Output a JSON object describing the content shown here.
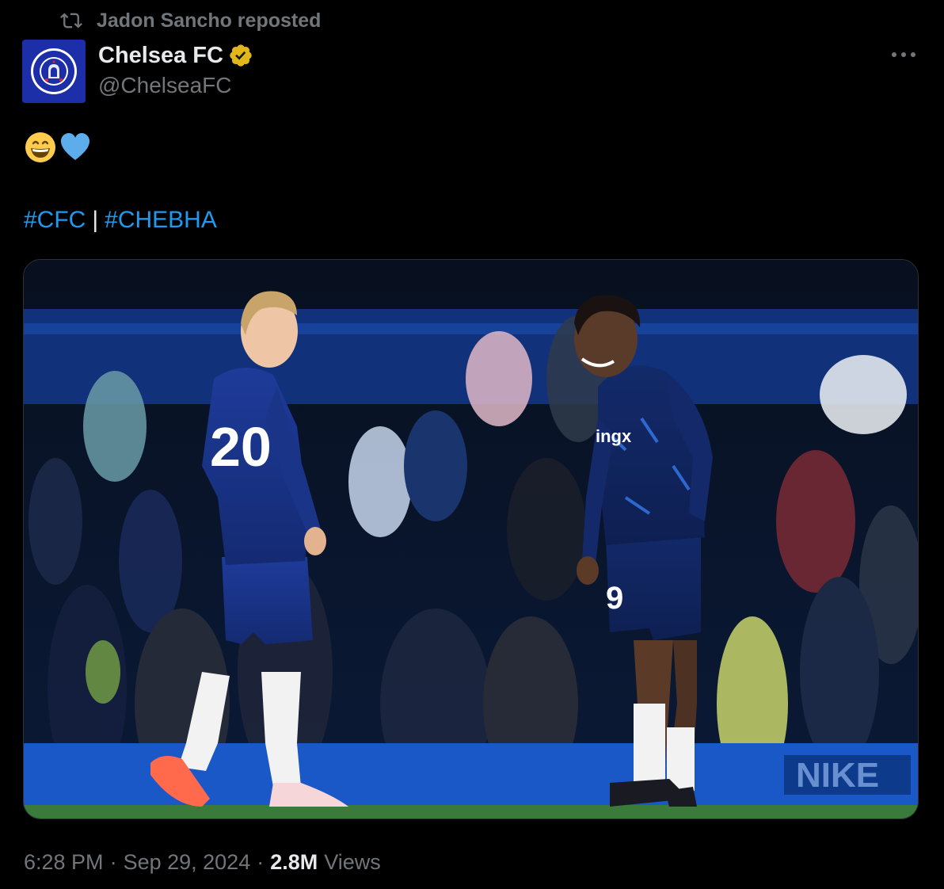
{
  "repost": {
    "icon": "repost-icon",
    "text": "Jadon Sancho reposted"
  },
  "author": {
    "display_name": "Chelsea FC",
    "handle": "@ChelseaFC",
    "verified_badge": "verified-gold-badge-icon",
    "avatar": "chelsea-crest",
    "avatar_color": "#1c2fa8"
  },
  "more_menu": {
    "icon": "more-horizontal-icon"
  },
  "tweet": {
    "emojis": [
      "grinning-face-emoji",
      "blue-heart-emoji"
    ],
    "hashtag_1": "#CFC",
    "separator": "|",
    "hashtag_2": "#CHEBHA"
  },
  "media": {
    "type": "photo",
    "description_icon": "photo"
  },
  "meta": {
    "time": "6:28 PM",
    "dot": "·",
    "date": "Sep 29, 2024",
    "views_count": "2.8M",
    "views_label": "Views"
  },
  "colors": {
    "background": "#000000",
    "text_primary": "#e7e9ea",
    "text_secondary": "#71767b",
    "link": "#1d9bf0",
    "border": "#2f3336",
    "verified_gold": "#e2b719"
  }
}
